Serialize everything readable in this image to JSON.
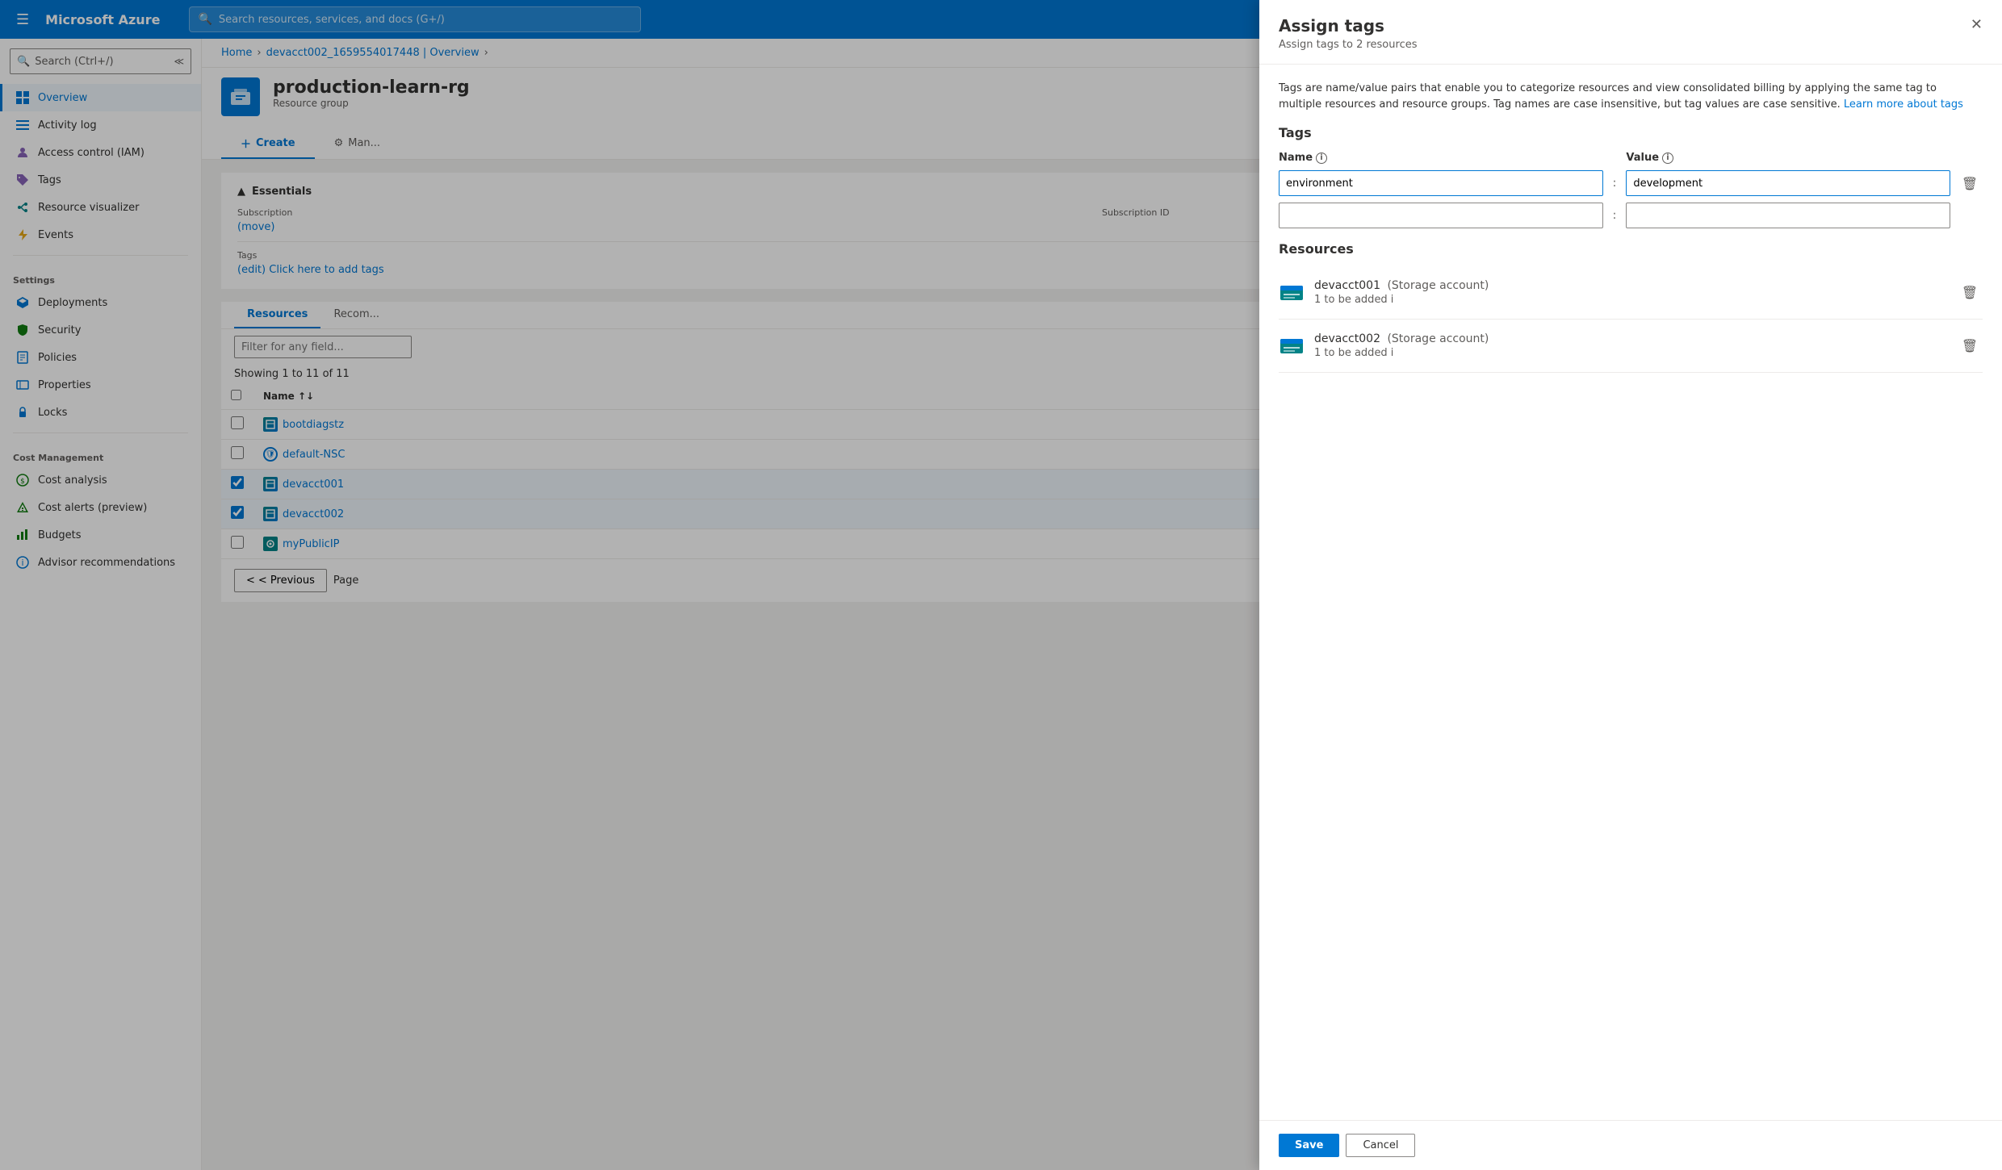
{
  "topbar": {
    "logo": "Microsoft Azure",
    "search_placeholder": "Search resources, services, and docs (G+/)",
    "hamburger": "☰"
  },
  "breadcrumb": {
    "home": "Home",
    "parent": "devacct002_1659554017448 | Overview",
    "sep": "›"
  },
  "resource": {
    "title": "production-learn-rg",
    "subtitle": "Resource group",
    "nav_tabs": [
      "Overview",
      "Activity log",
      "Access control (IAM)",
      "Tags",
      "Events",
      "Deployments",
      "Security",
      "Policies",
      "Properties",
      "Locks"
    ]
  },
  "essentials": {
    "header": "Essentials",
    "subscription_label": "Subscription",
    "subscription_value": "(move)",
    "subscription_id_label": "Subscription ID",
    "subscription_id_value": "",
    "tags_label": "Tags",
    "tags_value": "Click here to add tags",
    "tags_link": "(edit)"
  },
  "tabs": {
    "resources": "Resources",
    "recommendations": "Recom..."
  },
  "filter": {
    "placeholder": "Filter for any field..."
  },
  "showing": "Showing 1 to 11 of 11",
  "table": {
    "headers": [
      "Name",
      ""
    ],
    "sort_icon": "↑↓",
    "rows": [
      {
        "id": "bootdiagstz",
        "name": "bootdiagstz",
        "type": "storage",
        "checked": false
      },
      {
        "id": "default-NSC",
        "name": "default-NSC",
        "type": "nsg",
        "checked": false
      },
      {
        "id": "devacct001",
        "name": "devacct001",
        "type": "storage",
        "checked": true
      },
      {
        "id": "devacct002",
        "name": "devacct002",
        "type": "storage",
        "checked": true
      },
      {
        "id": "myPublicIP",
        "name": "myPublicIP",
        "type": "ip",
        "checked": false
      }
    ]
  },
  "pagination": {
    "previous": "< Previous",
    "page": "Page"
  },
  "sidebar": {
    "search_placeholder": "Search (Ctrl+/)",
    "items": [
      {
        "id": "overview",
        "label": "Overview",
        "icon": "grid",
        "active": true,
        "group": "main"
      },
      {
        "id": "activity-log",
        "label": "Activity log",
        "icon": "list",
        "active": false,
        "group": "main"
      },
      {
        "id": "access-control",
        "label": "Access control (IAM)",
        "icon": "person",
        "active": false,
        "group": "main"
      },
      {
        "id": "tags",
        "label": "Tags",
        "icon": "tag",
        "active": false,
        "group": "main"
      },
      {
        "id": "resource-visualizer",
        "label": "Resource visualizer",
        "icon": "visualizer",
        "active": false,
        "group": "main"
      },
      {
        "id": "events",
        "label": "Events",
        "icon": "lightning",
        "active": false,
        "group": "main"
      },
      {
        "id": "deployments",
        "label": "Deployments",
        "icon": "deploy",
        "group": "Settings"
      },
      {
        "id": "security",
        "label": "Security",
        "icon": "shield",
        "group": "Settings"
      },
      {
        "id": "policies",
        "label": "Policies",
        "icon": "policy",
        "group": "Settings"
      },
      {
        "id": "properties",
        "label": "Properties",
        "icon": "properties",
        "group": "Settings"
      },
      {
        "id": "locks",
        "label": "Locks",
        "icon": "lock",
        "group": "Settings"
      },
      {
        "id": "cost-analysis",
        "label": "Cost analysis",
        "icon": "cost",
        "group": "Cost Management"
      },
      {
        "id": "cost-alerts",
        "label": "Cost alerts (preview)",
        "icon": "alert-cost",
        "group": "Cost Management"
      },
      {
        "id": "budgets",
        "label": "Budgets",
        "icon": "budgets",
        "group": "Cost Management"
      },
      {
        "id": "advisor",
        "label": "Advisor recommendations",
        "icon": "advisor",
        "group": "Cost Management"
      }
    ]
  },
  "panel": {
    "title": "Assign tags",
    "subtitle": "Assign tags to 2 resources",
    "description": "Tags are name/value pairs that enable you to categorize resources and view consolidated billing by applying the same tag to multiple resources and resource groups. Tag names are case insensitive, but tag values are case sensitive.",
    "learn_more": "Learn more about tags",
    "tags_section": "Tags",
    "name_col": "Name",
    "value_col": "Value",
    "tag1_name": "environment",
    "tag1_value": "development",
    "tag2_name": "",
    "tag2_value": "",
    "resources_section": "Resources",
    "resources": [
      {
        "id": "devacct001",
        "name": "devacct001",
        "type": "Storage account",
        "status": "1 to be added"
      },
      {
        "id": "devacct002",
        "name": "devacct002",
        "type": "Storage account",
        "status": "1 to be added"
      }
    ],
    "save_label": "Save",
    "cancel_label": "Cancel"
  }
}
